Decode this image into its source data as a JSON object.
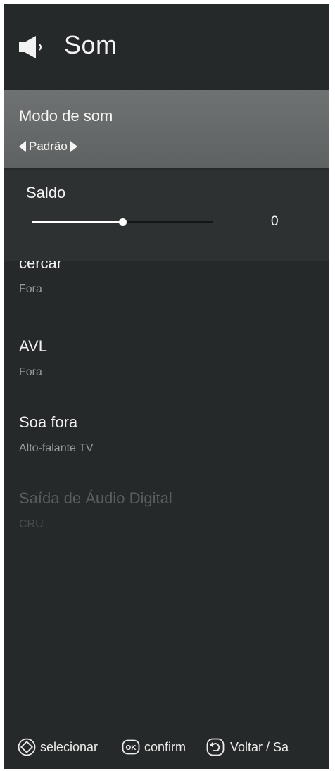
{
  "header": {
    "title": "Som",
    "icon": "speaker-icon"
  },
  "menu": {
    "sound_mode": {
      "label": "Modo de som",
      "value": "Padrão"
    },
    "balance": {
      "label": "Saldo",
      "value": "0",
      "level_fraction": 0.5
    },
    "surround": {
      "label": "cercar",
      "value": "Fora"
    },
    "avl": {
      "label": "AVL",
      "value": "Fora"
    },
    "sound_out": {
      "label": "Soa fora",
      "value": "Alto-falante TV"
    },
    "digital_audio_out": {
      "label": "Saída de Áudio Digital",
      "value": "CRU",
      "disabled": true
    }
  },
  "footer": {
    "select_label": "selecionar",
    "confirm_label": "confirm",
    "back_label": "Voltar / Sa",
    "icons": [
      "dpad-icon",
      "ok-button-icon",
      "back-icon"
    ]
  },
  "colors": {
    "background": "#262929",
    "selected_item": "#6f7272",
    "text": "#f4f4f4",
    "subtext": "#9a9c9c",
    "disabled_text": "#5a5d5d"
  }
}
